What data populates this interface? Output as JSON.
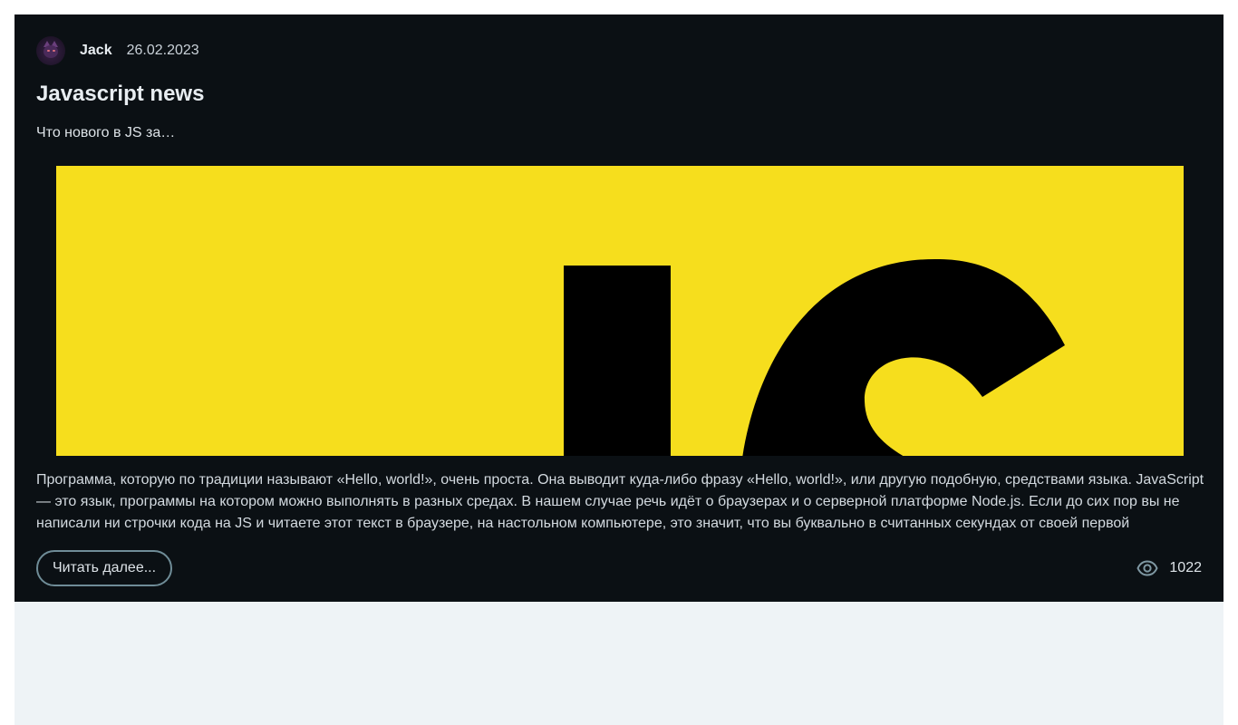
{
  "post": {
    "author": "Jack",
    "date": "26.02.2023",
    "title": "Javascript news",
    "excerpt": "Что нового в JS за…",
    "cover_text": "JS",
    "body": "Программа, которую по традиции называют «Hello, world!», очень проста. Она выводит куда-либо фразу «Hello, world!», или другую подобную, средствами языка. JavaScript — это язык, программы на котором можно выполнять в разных средах. В нашем случае речь идёт о браузерах и о серверной платформе Node.js. Если до сих пор вы не написали ни строчки кода на JS и читаете этот текст в браузере, на настольном компьютере, это значит, что вы буквально в считанных секундах от своей первой",
    "read_more_label": "Читать далее...",
    "views": "1022"
  },
  "icons": {
    "avatar": "cat-avatar",
    "views": "eye-icon"
  },
  "colors": {
    "card_background": "#0b1014",
    "page_background": "#eef3f6",
    "cover_yellow": "#f6de1d",
    "button_border": "#6f8c97",
    "text": "#dde3e8"
  }
}
